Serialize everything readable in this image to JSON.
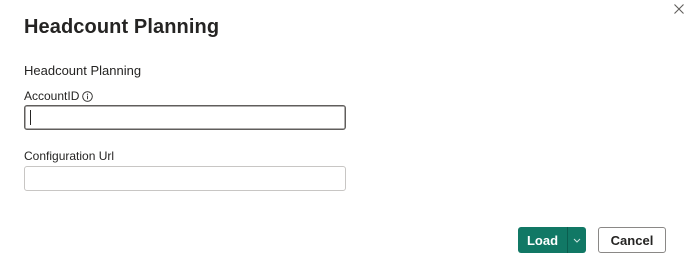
{
  "dialog": {
    "title": "Headcount Planning",
    "close_icon": "close-icon"
  },
  "form": {
    "section_title": "Headcount Planning",
    "account_id": {
      "label": "AccountID",
      "info_icon": "info-icon",
      "value": ""
    },
    "configuration_url": {
      "label": "Configuration Url",
      "value": ""
    }
  },
  "footer": {
    "load_label": "Load",
    "load_dropdown_icon": "chevron-down-icon",
    "cancel_label": "Cancel"
  },
  "colors": {
    "primary": "#117865",
    "text": "#252423",
    "border": "#8a8886"
  }
}
